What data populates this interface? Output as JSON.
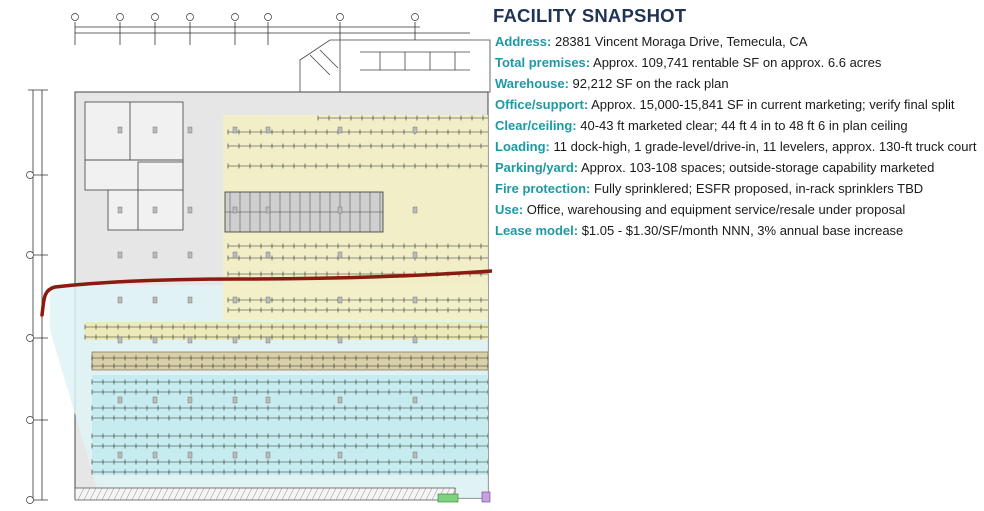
{
  "panel": {
    "title": "FACILITY SNAPSHOT",
    "rows": [
      {
        "label": "Address:",
        "value": "28381 Vincent Moraga Drive, Temecula, CA"
      },
      {
        "label": "Total premises:",
        "value": "Approx. 109,741 rentable SF on approx. 6.6 acres"
      },
      {
        "label": "Warehouse:",
        "value": "92,212 SF on the rack plan"
      },
      {
        "label": "Office/support:",
        "value": "Approx. 15,000-15,841 SF in current marketing; verify final split"
      },
      {
        "label": "Clear/ceiling:",
        "value": "40-43 ft marketed clear; 44 ft 4 in to 48 ft 6 in plan ceiling"
      },
      {
        "label": "Loading:",
        "value": "11 dock-high, 1 grade-level/drive-in, 11 levelers, approx. 130-ft truck court"
      },
      {
        "label": "Parking/yard:",
        "value": "Approx. 103-108 spaces; outside-storage capability marketed"
      },
      {
        "label": "Fire protection:",
        "value": "Fully sprinklered; ESFR proposed, in-rack sprinklers TBD"
      },
      {
        "label": "Use:",
        "value": "Office, warehousing and equipment service/resale under proposal"
      },
      {
        "label": "Lease model:",
        "value": "$1.05 - $1.30/SF/month NNN, 3% annual base increase"
      }
    ]
  },
  "colors": {
    "title": "#1f3355",
    "label": "#1b9aa6",
    "markup_line": "#8b1a10",
    "zone_yellow": "#f3f0c4",
    "zone_cyan": "#c6ecf0",
    "zone_light_cyan": "#dff3f6",
    "floor_gray": "#e6e6e6"
  }
}
